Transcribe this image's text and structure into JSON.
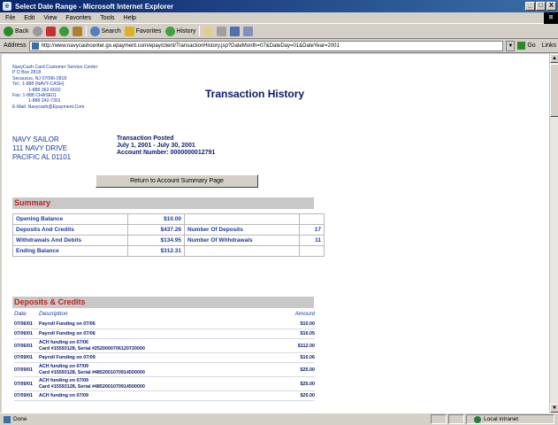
{
  "window": {
    "title": "Select Date Range - Microsoft Internet Explorer",
    "controls": [
      "_",
      "□",
      "X"
    ]
  },
  "menu": [
    "File",
    "Edit",
    "View",
    "Favorites",
    "Tools",
    "Help"
  ],
  "toolbar": {
    "back": "Back",
    "search": "Search",
    "favorites": "Favorites",
    "history": "History"
  },
  "address": {
    "label": "Address",
    "url": "http://www.navycashcenter.go.epayment.com/epay/client/TransactionHistory.jsp?DateMonth=07&DateDay=01&DateYear=2001",
    "go": "Go",
    "links": "Links"
  },
  "contact": {
    "lines": [
      "NavyCash Card Customer Service Center",
      "P O Box 2818",
      "Secaucus, NJ 07096-2818",
      "Tel.: 1-888 (NAVY-CASH)",
      "1-888 362-6602",
      "Fax: 1-888 CHASE01",
      "1-888 242-7301",
      "E-Mail: Navycash@Epayment.Com"
    ]
  },
  "page_title": "Transaction History",
  "customer": {
    "name": "NAVY SAILOR",
    "address1": "111 NAVY DRIVE",
    "address2": "PACIFIC AL 01101"
  },
  "period": {
    "label": "Transaction Posted",
    "range": "July 1, 2001 - July 30, 2001",
    "account": "Account Number: 0000000012791"
  },
  "return_button": "Return to Account Summary Page",
  "summary": {
    "heading": "Summary",
    "opening_label": "Opening Balance",
    "opening_value": "$10.00",
    "deposits_label": "Deposits And Credits",
    "deposits_value": "$437.26",
    "num_deposits_label": "Number Of Deposits",
    "num_deposits_value": "17",
    "withdrawals_label": "Withdrawals And Debits",
    "withdrawals_value": "$134.95",
    "num_withdrawals_label": "Number Of Withdrawals",
    "num_withdrawals_value": "11",
    "ending_label": "Ending Balance",
    "ending_value": "$312.31"
  },
  "deposits": {
    "heading": "Deposits & Credits",
    "col_date": "Date",
    "col_desc": "Description",
    "col_amount": "Amount",
    "rows": [
      {
        "date": "07/06/01",
        "line1": "Payroll Funding on 07/06",
        "line2": "",
        "amount": "$10.00"
      },
      {
        "date": "07/06/01",
        "line1": "Payroll Funding on 07/06",
        "line2": "",
        "amount": "$10.05"
      },
      {
        "date": "07/06/01",
        "line1": "ACH funding on 07/06",
        "line2": "Card #15593128, Serial #2520000706120720000",
        "amount": "$112.00"
      },
      {
        "date": "07/09/01",
        "line1": "Payroll Funding on 07/09",
        "line2": "",
        "amount": "$10.06"
      },
      {
        "date": "07/09/01",
        "line1": "ACH funding on 07/09",
        "line2": "Card #15593128, Serial #4852001070914500000",
        "amount": "$25.00"
      },
      {
        "date": "07/09/01",
        "line1": "ACH funding on 07/09",
        "line2": "Card #15593128, Serial #4852001070914500000",
        "amount": "$25.00"
      },
      {
        "date": "07/09/01",
        "line1": "ACH funding on 07/09",
        "line2": "",
        "amount": "$25.00"
      }
    ]
  },
  "status": {
    "left": "Done",
    "zone": "Local intranet"
  }
}
